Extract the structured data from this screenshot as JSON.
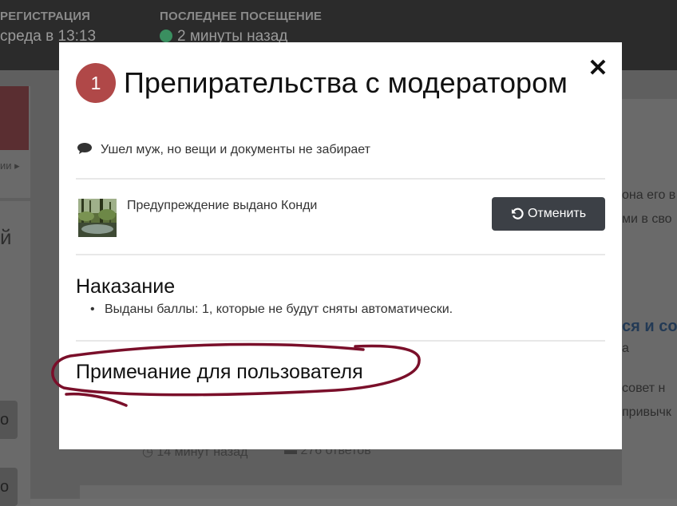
{
  "background": {
    "registration_label": "РЕГИСТРАЦИЯ",
    "registration_value": "среда в 13:13",
    "last_visit_label": "ПОСЛЕДНЕЕ ПОСЕЩЕНИЕ",
    "last_visit_value": "2 минуты назад",
    "left_link": "ии",
    "left_btn_1": "о",
    "left_btn_2": "о",
    "right_text_1": "она его в",
    "right_text_2": "ми в сво",
    "right_title": "ся и со",
    "right_sub": "а",
    "right_text_3": "совет н",
    "right_text_4": "привычк",
    "left_letter": "й",
    "time_ago": "14 минут назад",
    "replies": "276 ответов"
  },
  "modal": {
    "badge": "1",
    "title": "Препирательства с модератором",
    "subtitle": "Ушел муж, но вещи и документы не забирает",
    "warning_text": "Предупреждение выдано Конди",
    "revert_label": "Отменить",
    "punishment_heading": "Наказание",
    "punishment_items": [
      "Выданы баллы: 1, которые не будут сняты автоматически."
    ],
    "note_heading": "Примечание для пользователя",
    "close_icon": "close-icon",
    "revert_icon": "undo-icon"
  },
  "colors": {
    "badge": "#b04848",
    "revert_button": "#3c4046",
    "annotation": "#7a0f2a"
  }
}
